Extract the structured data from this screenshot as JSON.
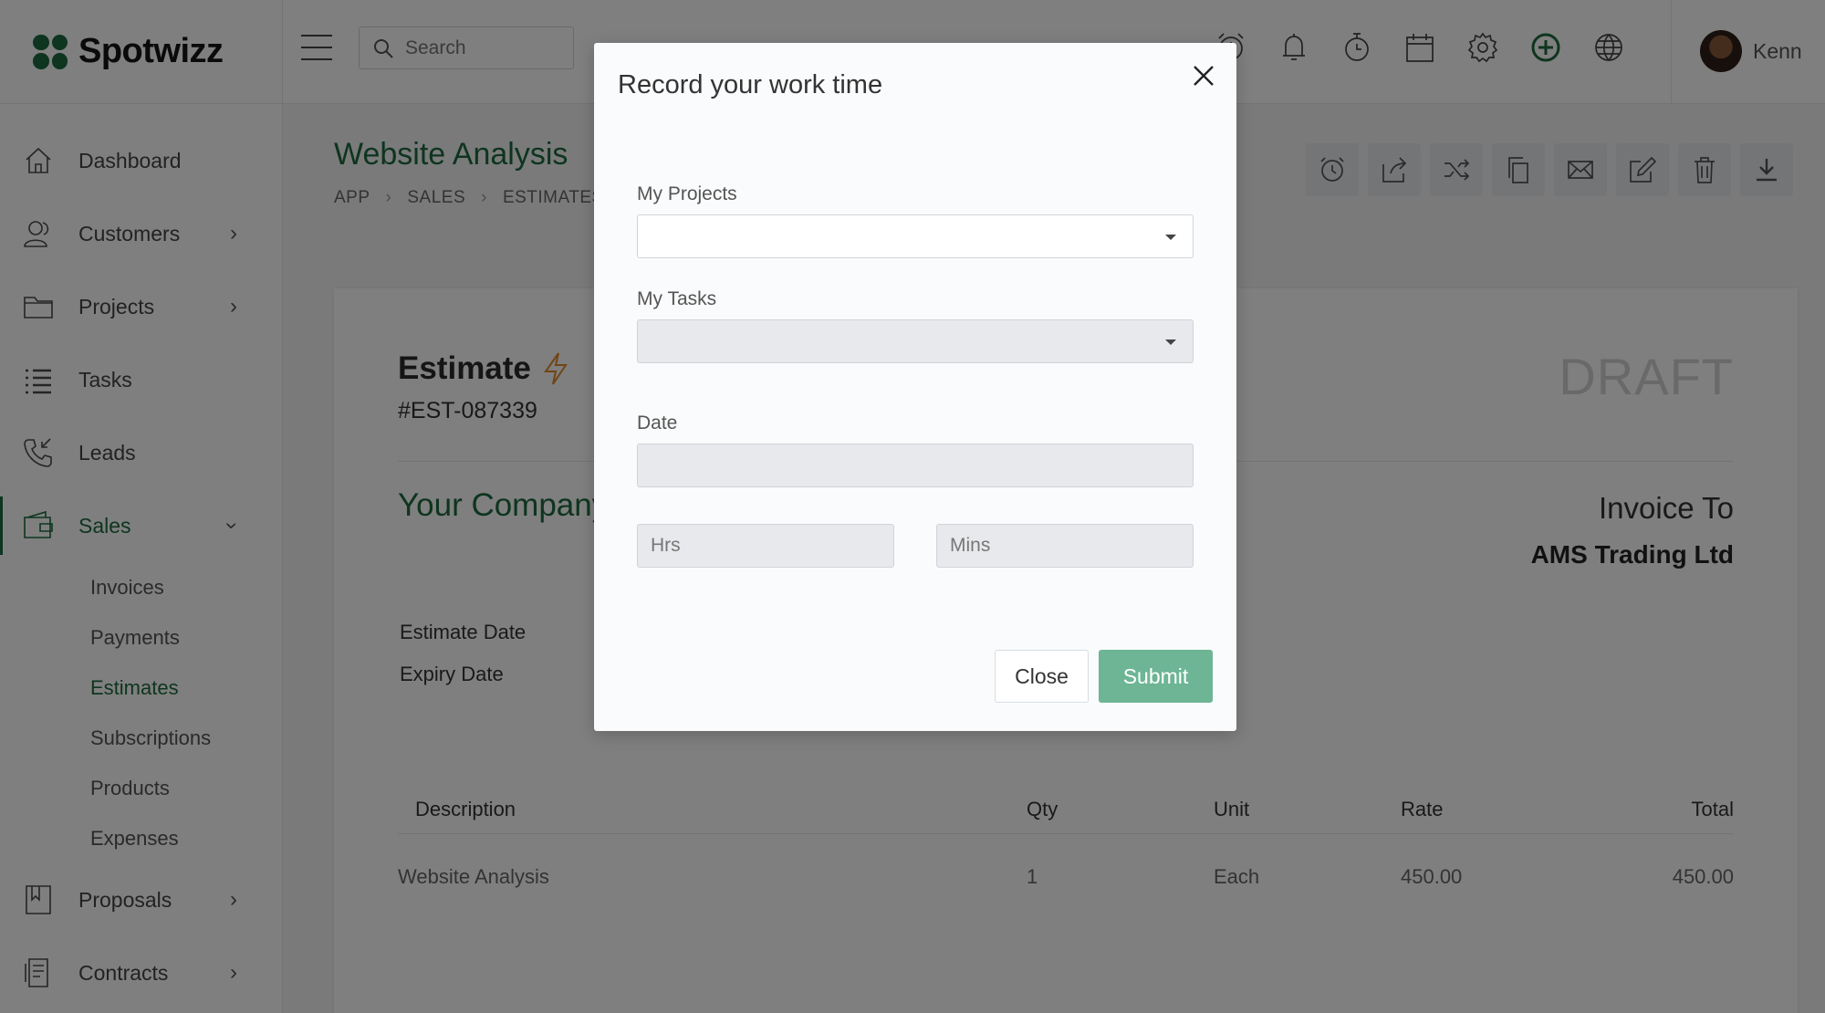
{
  "brand": {
    "name": "Spotwizz"
  },
  "sidebar": {
    "items": [
      {
        "label": "Dashboard",
        "icon": "home-icon"
      },
      {
        "label": "Customers",
        "icon": "users-icon"
      },
      {
        "label": "Projects",
        "icon": "folder-icon"
      },
      {
        "label": "Tasks",
        "icon": "list-icon"
      },
      {
        "label": "Leads",
        "icon": "phone-icon"
      },
      {
        "label": "Sales",
        "icon": "wallet-icon"
      },
      {
        "label": "Proposals",
        "icon": "bookmark-icon"
      },
      {
        "label": "Contracts",
        "icon": "contract-icon"
      }
    ],
    "sales_sub": [
      "Invoices",
      "Payments",
      "Estimates",
      "Subscriptions",
      "Products",
      "Expenses"
    ]
  },
  "topbar": {
    "search_placeholder": "Search",
    "icons": [
      "alarm-icon",
      "bell-icon",
      "stopwatch-icon",
      "calendar-icon",
      "gear-icon",
      "add-circle-icon",
      "globe-icon"
    ],
    "user_name": "Kenn"
  },
  "page": {
    "title": "Website Analysis",
    "breadcrumb": [
      "APP",
      "SALES",
      "ESTIMATES"
    ]
  },
  "estimate": {
    "heading": "Estimate",
    "number": "#EST-087339",
    "status": "DRAFT",
    "company": "Your Company",
    "invoice_to_label": "Invoice To",
    "client": "AMS Trading Ltd",
    "estimate_date_label": "Estimate Date",
    "expiry_date_label": "Expiry Date",
    "table": {
      "headers": [
        "Description",
        "Qty",
        "Unit",
        "Rate",
        "Total"
      ],
      "rows": [
        [
          "Website Analysis",
          "1",
          "Each",
          "450.00",
          "450.00"
        ]
      ]
    }
  },
  "modal": {
    "title": "Record your work time",
    "projects_label": "My Projects",
    "tasks_label": "My Tasks",
    "date_label": "Date",
    "hrs_placeholder": "Hrs",
    "mins_placeholder": "Mins",
    "close_label": "Close",
    "submit_label": "Submit"
  },
  "colors": {
    "brand": "#1d6b3e",
    "submit": "#6db595",
    "accent_bolt": "#e08a2a"
  }
}
